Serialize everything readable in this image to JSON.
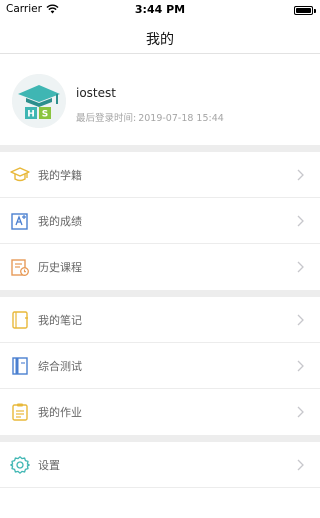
{
  "status_bar": {
    "carrier": "Carrier",
    "time": "3:44 PM"
  },
  "nav": {
    "title": "我的"
  },
  "profile": {
    "username": "iostest",
    "last_login_label": "最后登录时间:",
    "last_login_value": "2019-07-18 15:44",
    "avatar_letters": [
      "H",
      "S"
    ]
  },
  "menu": {
    "group1": [
      {
        "label": "我的学籍",
        "icon": "graduation-cap-icon"
      },
      {
        "label": "我的成绩",
        "icon": "grade-chart-icon"
      },
      {
        "label": "历史课程",
        "icon": "course-history-icon"
      }
    ],
    "group2": [
      {
        "label": "我的笔记",
        "icon": "notebook-icon"
      },
      {
        "label": "综合测试",
        "icon": "test-book-icon"
      },
      {
        "label": "我的作业",
        "icon": "homework-clipboard-icon"
      }
    ],
    "group3": [
      {
        "label": "设置",
        "icon": "settings-gear-icon"
      }
    ]
  },
  "colors": {
    "accent_teal": "#3fb6b3",
    "icon_yellow": "#e8b83a",
    "icon_blue": "#4a7fd0",
    "icon_orange": "#e79a57"
  }
}
